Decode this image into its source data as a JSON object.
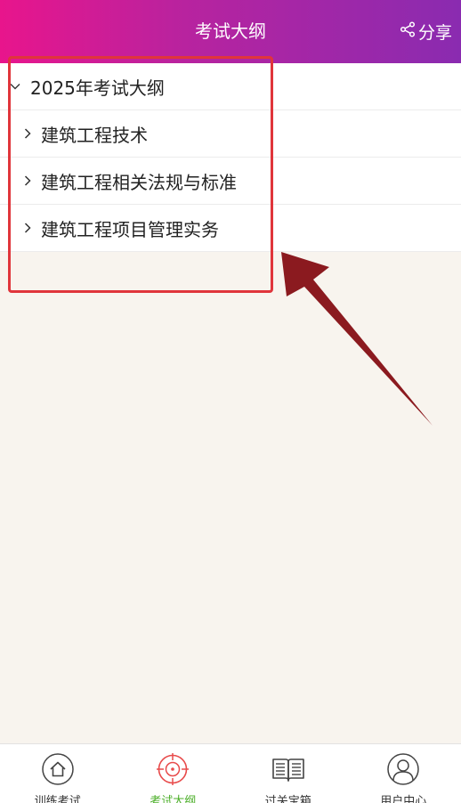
{
  "header": {
    "title": "考试大纲",
    "share_label": "分享"
  },
  "tree": {
    "root_label": "2025年考试大纲",
    "children": [
      {
        "label": "建筑工程技术"
      },
      {
        "label": "建筑工程相关法规与标准"
      },
      {
        "label": "建筑工程项目管理实务"
      }
    ]
  },
  "tabbar": {
    "tabs": [
      {
        "label": "训练考试",
        "icon": "home-icon"
      },
      {
        "label": "考试大纲",
        "icon": "target-icon",
        "active": true
      },
      {
        "label": "过关宝箱",
        "icon": "book-icon"
      },
      {
        "label": "用户中心",
        "icon": "user-icon"
      }
    ]
  },
  "colors": {
    "header_gradient_start": "#e8158c",
    "header_gradient_end": "#8a2bb0",
    "highlight_box": "#e0353b",
    "annotation_arrow": "#8b1a1f",
    "active_tab": "#4caf2a",
    "background": "#f8f4ee"
  }
}
